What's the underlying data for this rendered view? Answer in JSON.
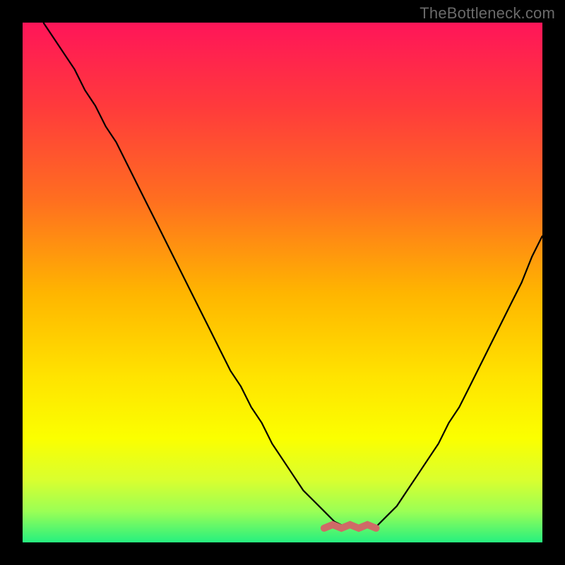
{
  "watermark": "TheBottleneck.com",
  "colors": {
    "frame": "#000000",
    "curve": "#000000",
    "trough_marker": "#cf6a67",
    "gradient_stops": [
      {
        "offset": 0.0,
        "color": "#ff1559"
      },
      {
        "offset": 0.16,
        "color": "#ff3a3c"
      },
      {
        "offset": 0.34,
        "color": "#ff6e20"
      },
      {
        "offset": 0.52,
        "color": "#ffb500"
      },
      {
        "offset": 0.68,
        "color": "#ffe300"
      },
      {
        "offset": 0.8,
        "color": "#fbff00"
      },
      {
        "offset": 0.88,
        "color": "#d9ff2f"
      },
      {
        "offset": 0.94,
        "color": "#9bff55"
      },
      {
        "offset": 1.0,
        "color": "#26f07f"
      }
    ]
  },
  "chart_data": {
    "type": "line",
    "title": "",
    "xlabel": "",
    "ylabel": "",
    "xlim": [
      0,
      100
    ],
    "ylim": [
      0,
      100
    ],
    "grid": false,
    "legend": false,
    "notes": "V-shaped bottleneck curve. Height ≈ mismatch; minimum lies around x≈62–68 at y≈3. Left branch starts near top-left, right branch ends near mid-right edge.",
    "x": [
      4,
      6,
      8,
      10,
      12,
      14,
      16,
      18,
      20,
      22,
      24,
      26,
      28,
      30,
      32,
      34,
      36,
      38,
      40,
      42,
      44,
      46,
      48,
      50,
      52,
      54,
      56,
      58,
      60,
      62,
      64,
      66,
      68,
      70,
      72,
      74,
      76,
      78,
      80,
      82,
      84,
      86,
      88,
      90,
      92,
      94,
      96,
      98,
      100
    ],
    "values": [
      100,
      97,
      94,
      91,
      87,
      84,
      80,
      77,
      73,
      69,
      65,
      61,
      57,
      53,
      49,
      45,
      41,
      37,
      33,
      30,
      26,
      23,
      19,
      16,
      13,
      10,
      8,
      6,
      4,
      3,
      3,
      3,
      3,
      5,
      7,
      10,
      13,
      16,
      19,
      23,
      26,
      30,
      34,
      38,
      42,
      46,
      50,
      55,
      59
    ],
    "trough_marker": {
      "x_start": 58,
      "x_end": 68,
      "y": 3
    }
  }
}
